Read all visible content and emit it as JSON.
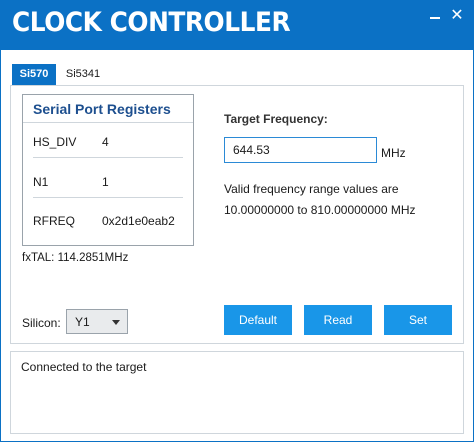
{
  "window": {
    "title": "CLOCK CONTROLLER",
    "minimize_icon": "minimize-icon",
    "close_icon": "close-icon",
    "close_glyph": "✕",
    "accent_color": "#0b71c5"
  },
  "tabs": [
    {
      "label": "Si570",
      "active": true
    },
    {
      "label": "Si5341",
      "active": false
    }
  ],
  "registers": {
    "title": "Serial Port Registers",
    "rows": [
      {
        "label": "HS_DIV",
        "value": "4"
      },
      {
        "label": "N1",
        "value": "1"
      },
      {
        "label": "RFREQ",
        "value": "0x2d1e0eab2"
      }
    ]
  },
  "fxtal": "fxTAL: 114.2851MHz",
  "target": {
    "label": "Target Frequency:",
    "value": "644.53",
    "unit": "MHz",
    "range_line1": "Valid frequency range values are",
    "range_line2": "10.00000000 to 810.00000000 MHz"
  },
  "silicon": {
    "label": "Silicon:",
    "selected": "Y1"
  },
  "buttons": {
    "default_label": "Default",
    "read_label": "Read",
    "set_label": "Set",
    "color": "#1996e8"
  },
  "status": {
    "text": "Connected to the target"
  }
}
